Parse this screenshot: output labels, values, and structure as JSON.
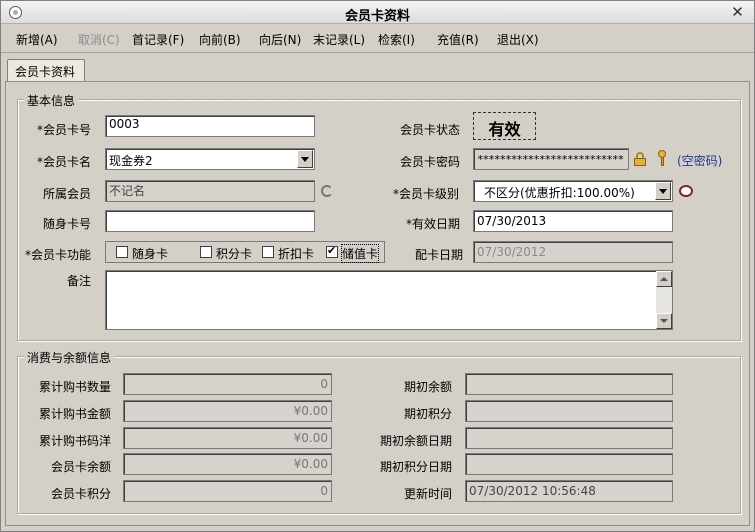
{
  "window": {
    "title": "会员卡资料"
  },
  "menu": [
    "新增(A)",
    "取消(C)",
    "首记录(F)",
    "向前(B)",
    "向后(N)",
    "末记录(L)",
    "检索(I)",
    "充值(R)",
    "退出(X)"
  ],
  "tab": {
    "label": "会员卡资料"
  },
  "basic": {
    "legend": "基本信息",
    "card_no_label": "*会员卡号",
    "card_no": "0003",
    "card_name_label": "*会员卡名",
    "card_name": "现金券2",
    "member_label": "所属会员",
    "member": "不记名",
    "carry_no_label": "随身卡号",
    "carry_no": "",
    "func_label": "*会员卡功能",
    "functions": [
      {
        "label": "随身卡",
        "checked": false
      },
      {
        "label": "积分卡",
        "checked": false
      },
      {
        "label": "折扣卡",
        "checked": false
      },
      {
        "label": "储值卡",
        "checked": true
      }
    ],
    "remark_label": "备注",
    "remark": "",
    "status_label": "会员卡状态",
    "status": "有效",
    "password_label": "会员卡密码",
    "password": "**************************",
    "empty_pwd_link": "(空密码)",
    "level_label": "*会员卡级别",
    "level": "不区分(优惠折扣:100.00%)",
    "expire_label": "*有效日期",
    "expire": "07/30/2013",
    "issue_label": "配卡日期",
    "issue": "07/30/2012"
  },
  "balance": {
    "legend": "消费与余额信息",
    "total_qty_label": "累计购书数量",
    "total_qty": "0",
    "total_amount_label": "累计购书金额",
    "total_amount": "¥0.00",
    "total_list_label": "累计购书码洋",
    "total_list": "¥0.00",
    "balance_label": "会员卡余额",
    "balance": "¥0.00",
    "points_label": "会员卡积分",
    "points": "0",
    "init_balance_label": "期初余额",
    "init_balance": "",
    "init_points_label": "期初积分",
    "init_points": "",
    "init_balance_date_label": "期初余额日期",
    "init_balance_date": "",
    "init_points_date_label": "期初积分日期",
    "init_points_date": "",
    "update_time_label": "更新时间",
    "update_time": "07/30/2012 10:56:48"
  }
}
